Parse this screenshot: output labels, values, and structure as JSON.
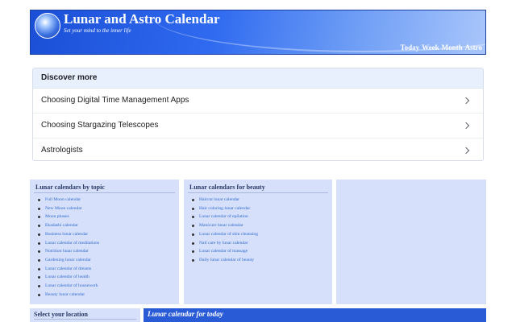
{
  "header": {
    "title": "Lunar and Astro Calendar",
    "tagline": "Set your mind to the inner life",
    "nav": [
      "Today",
      "Week",
      "Month",
      "Astro"
    ]
  },
  "discover": {
    "heading": "Discover more",
    "items": [
      "Choosing Digital Time Management Apps",
      "Choosing Stargazing Telescopes",
      "Astrologists"
    ]
  },
  "topics": {
    "heading": "Lunar calendars by topic",
    "items": [
      "Full Moon calendar",
      "New Moon calendar",
      "Moon phases",
      "Ekadashi calendar",
      "Business lunar calendar",
      "Lunar calendar of meditations",
      "Nutrition lunar calendar",
      "Gardening lunar calendar",
      "Lunar calendar of dreams",
      "Lunar calendar of health",
      "Lunar calendar of housework",
      "Beauty lunar calendar"
    ]
  },
  "beauty": {
    "heading": "Lunar calendars for beauty",
    "items": [
      "Haircut lunar calendar",
      "Hair coloring lunar calendar",
      "Lunar calendar of epilation",
      "Manicure lunar calendar",
      "Lunar calendar of skin cleansing",
      "Nail care by lunar calendar",
      "Lunar calendar of massage",
      "Daily lunar calendar of beauty"
    ]
  },
  "location": {
    "heading": "Select your location"
  },
  "today": {
    "heading": "Lunar calendar for today"
  },
  "colors": {
    "banner": "#2f6af0",
    "panel": "#d6e0fb",
    "link": "#2f6ad0",
    "today_bar": "#2a5bd7"
  }
}
